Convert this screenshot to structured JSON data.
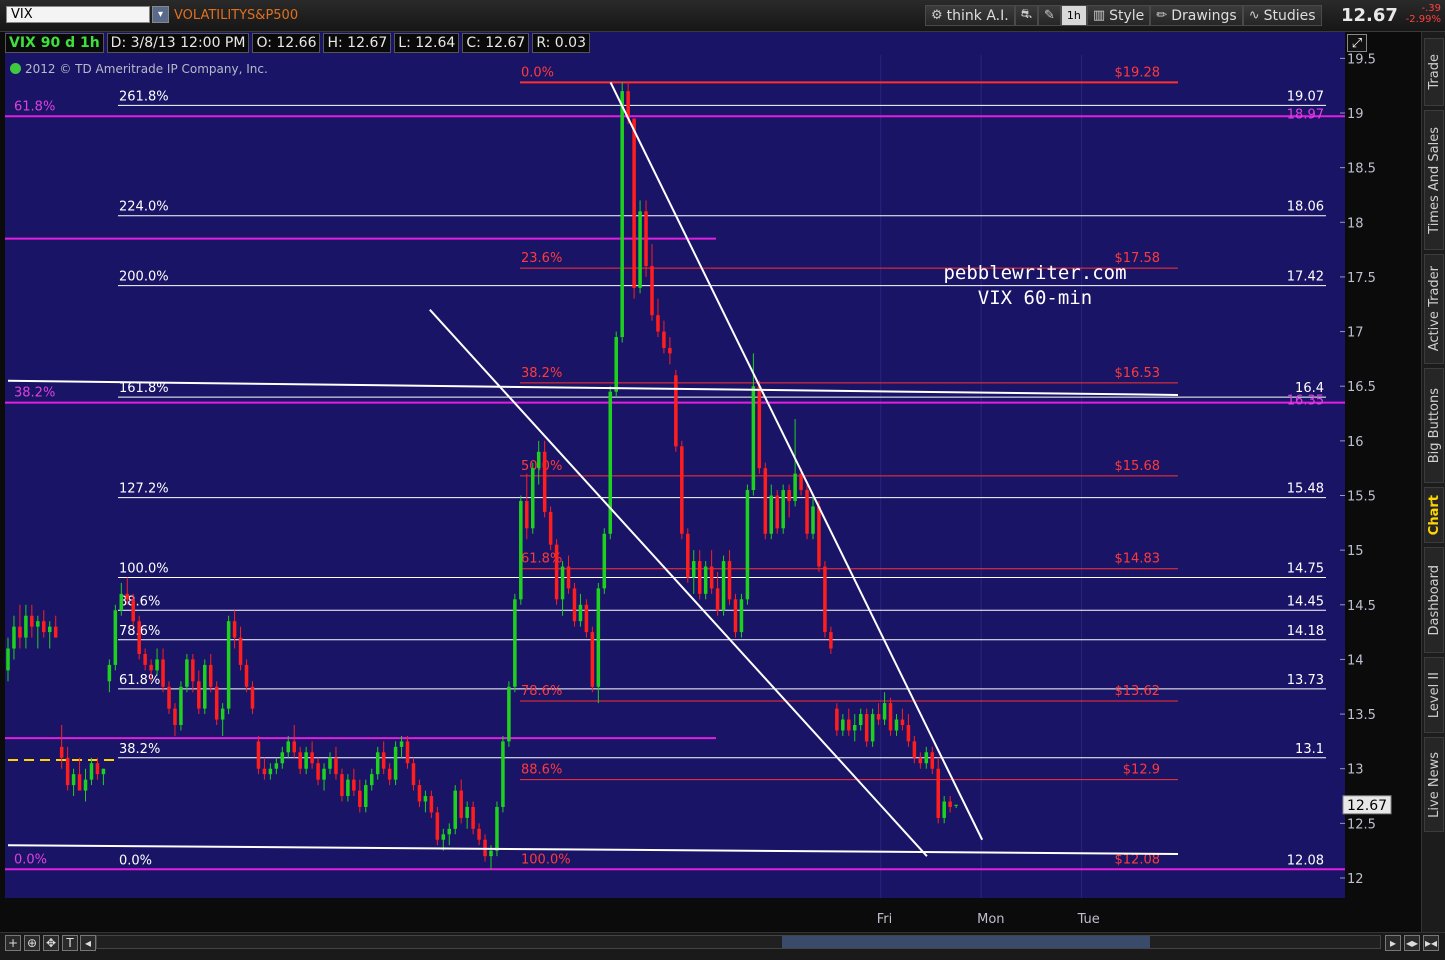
{
  "header": {
    "symbol": "VIX",
    "symbol_description": "VOLATILITYS&P500",
    "last_price": "12.67",
    "change": "-.39",
    "change_pct": "-2.99%",
    "toolbar": [
      {
        "name": "think-ai-button",
        "icon": "gear-icon",
        "label": "think A.I."
      },
      {
        "name": "style-button",
        "icon": "bar-chart-icon",
        "label": "Style"
      },
      {
        "name": "drawings-button",
        "icon": "pencil-icon",
        "label": "Drawings"
      },
      {
        "name": "studies-button",
        "icon": "wave-icon",
        "label": "Studies"
      }
    ],
    "timeframe_label": "1h"
  },
  "info_bar": {
    "symbol_period": "VIX 90 d 1h",
    "date": "D: 3/8/13 12:00 PM",
    "open": "O: 12.66",
    "high": "H: 12.67",
    "low": "L: 12.64",
    "close": "C: 12.67",
    "range": "R: 0.03"
  },
  "copyright": "2012 © TD Ameritrade IP Company, Inc.",
  "right_panel": {
    "tabs": [
      "Trade",
      "Times And Sales",
      "Active Trader",
      "Big Buttons",
      "Chart",
      "Dashboard",
      "Level II",
      "Live News"
    ],
    "active": "Chart"
  },
  "colors": {
    "background": "#1a1466",
    "up_candle": "#1fd11f",
    "down_candle": "#ff1e1e",
    "fib_red": "#ff3030",
    "fib_magenta": "#e020e0",
    "white_line": "#ffffff"
  },
  "chart_data": {
    "type": "candlestick",
    "title": "",
    "watermark": [
      "pebblewriter.com",
      "VIX 60-min"
    ],
    "ylim": [
      11.85,
      19.6
    ],
    "y_ticks": [
      12,
      12.5,
      13,
      13.5,
      14,
      14.5,
      15,
      15.5,
      16,
      16.5,
      17,
      17.5,
      18,
      18.5,
      19,
      19.5
    ],
    "x_tick_labels": [
      "Fri",
      "Mon",
      "Tue"
    ],
    "x_range_bars": [
      0,
      233
    ],
    "last_price_tag": 12.67,
    "fib_extension_white": [
      {
        "label": "261.8%",
        "price_label": "19.07",
        "value": 19.07
      },
      {
        "label": "224.0%",
        "price_label": "18.06",
        "value": 18.06
      },
      {
        "label": "200.0%",
        "price_label": "17.42",
        "value": 17.42
      },
      {
        "label": "161.8%",
        "price_label": "16.4",
        "value": 16.4
      },
      {
        "label": "127.2%",
        "price_label": "15.48",
        "value": 15.48
      },
      {
        "label": "100.0%",
        "price_label": "14.75",
        "value": 14.75
      },
      {
        "label": "88.6%",
        "price_label": "14.45",
        "value": 14.45
      },
      {
        "label": "78.6%",
        "price_label": "14.18",
        "value": 14.18
      },
      {
        "label": "61.8%",
        "price_label": "13.73",
        "value": 13.73
      },
      {
        "label": "38.2%",
        "price_label": "13.1",
        "value": 13.1
      },
      {
        "label": "0.0%",
        "price_label": "12.08",
        "value": 12.08
      }
    ],
    "fib_retracement_red": [
      {
        "label": "0.0%",
        "price_label": "$19.28",
        "value": 19.28
      },
      {
        "label": "23.6%",
        "price_label": "$17.58",
        "value": 17.58
      },
      {
        "label": "38.2%",
        "price_label": "$16.53",
        "value": 16.53
      },
      {
        "label": "50.0%",
        "price_label": "$15.68",
        "value": 15.68
      },
      {
        "label": "61.8%",
        "price_label": "$14.83",
        "value": 14.83
      },
      {
        "label": "78.6%",
        "price_label": "$13.62",
        "value": 13.62
      },
      {
        "label": "88.6%",
        "price_label": "$12.9",
        "value": 12.9
      },
      {
        "label": "100.0%",
        "price_label": "$12.08",
        "value": 12.08
      }
    ],
    "fib_magenta": [
      {
        "label": "61.8%",
        "price_label": "18.97",
        "value": 18.97,
        "x_end_bar": 233
      },
      {
        "label": "",
        "price_label": "",
        "value": 17.85,
        "x_end_bar": 141
      },
      {
        "label": "38.2%",
        "price_label": "16.35",
        "value": 16.35,
        "x_end_bar": 233
      },
      {
        "label": "",
        "price_label": "",
        "value": 13.28,
        "x_end_bar": 141
      },
      {
        "label": "0.0%",
        "price_label": "",
        "value": 12.08,
        "x_end_bar": 233
      }
    ],
    "trendlines": [
      {
        "from": [
          84,
          17.2
        ],
        "to": [
          183,
          12.2
        ]
      },
      {
        "from": [
          120,
          19.28
        ],
        "to": [
          194,
          12.35
        ]
      },
      {
        "from": [
          0,
          12.3
        ],
        "to": [
          233,
          12.22
        ]
      },
      {
        "from": [
          0,
          16.55
        ],
        "to": [
          233,
          16.42
        ]
      }
    ],
    "yellow_dashed": {
      "value": 13.08,
      "x_range_bars": [
        0,
        22
      ]
    },
    "candles": [
      [
        13.9,
        14.2,
        13.8,
        14.1
      ],
      [
        14.1,
        14.4,
        14.0,
        14.3
      ],
      [
        14.3,
        14.5,
        14.1,
        14.2
      ],
      [
        14.2,
        14.5,
        14.1,
        14.4
      ],
      [
        14.4,
        14.5,
        14.2,
        14.3
      ],
      [
        14.3,
        14.4,
        14.1,
        14.35
      ],
      [
        14.35,
        14.45,
        14.2,
        14.25
      ],
      [
        14.25,
        14.35,
        14.1,
        14.3
      ],
      [
        14.3,
        14.4,
        14.2,
        14.2
      ],
      [
        13.2,
        13.4,
        13.0,
        13.1
      ],
      [
        13.1,
        13.2,
        12.8,
        12.85
      ],
      [
        12.85,
        13.0,
        12.75,
        12.95
      ],
      [
        12.95,
        13.1,
        12.8,
        12.8
      ],
      [
        12.8,
        13.0,
        12.7,
        12.9
      ],
      [
        12.9,
        13.1,
        12.85,
        13.05
      ],
      [
        13.05,
        13.1,
        12.9,
        12.95
      ],
      [
        12.95,
        13.0,
        12.85,
        13.0
      ],
      [
        13.8,
        14.0,
        13.7,
        13.95
      ],
      [
        13.95,
        14.5,
        13.9,
        14.45
      ],
      [
        14.45,
        14.7,
        14.4,
        14.6
      ],
      [
        14.6,
        14.75,
        14.5,
        14.55
      ],
      [
        14.55,
        14.6,
        14.3,
        14.35
      ],
      [
        14.35,
        14.4,
        14.0,
        14.05
      ],
      [
        14.05,
        14.1,
        13.9,
        13.95
      ],
      [
        13.95,
        14.0,
        13.8,
        13.9
      ],
      [
        13.9,
        14.1,
        13.85,
        14.0
      ],
      [
        14.0,
        14.1,
        13.7,
        13.75
      ],
      [
        13.75,
        13.8,
        13.5,
        13.55
      ],
      [
        13.55,
        13.6,
        13.3,
        13.4
      ],
      [
        13.4,
        13.8,
        13.35,
        13.75
      ],
      [
        13.75,
        14.05,
        13.7,
        14.0
      ],
      [
        14.0,
        14.05,
        13.7,
        13.8
      ],
      [
        13.8,
        13.9,
        13.5,
        13.55
      ],
      [
        13.55,
        14.0,
        13.5,
        13.95
      ],
      [
        13.95,
        14.05,
        13.7,
        13.75
      ],
      [
        13.75,
        13.8,
        13.4,
        13.45
      ],
      [
        13.45,
        13.6,
        13.3,
        13.55
      ],
      [
        13.55,
        14.4,
        13.5,
        14.35
      ],
      [
        14.35,
        14.45,
        14.1,
        14.2
      ],
      [
        14.2,
        14.3,
        13.9,
        13.95
      ],
      [
        13.95,
        14.0,
        13.7,
        13.75
      ],
      [
        13.75,
        13.8,
        13.5,
        13.55
      ],
      [
        13.25,
        13.3,
        12.95,
        13.0
      ],
      [
        13.0,
        13.1,
        12.9,
        12.95
      ],
      [
        12.95,
        13.05,
        12.9,
        13.0
      ],
      [
        13.0,
        13.1,
        12.95,
        13.05
      ],
      [
        13.05,
        13.2,
        13.0,
        13.15
      ],
      [
        13.15,
        13.3,
        13.1,
        13.25
      ],
      [
        13.25,
        13.4,
        13.1,
        13.15
      ],
      [
        13.15,
        13.2,
        12.95,
        13.0
      ],
      [
        13.0,
        13.2,
        12.95,
        13.15
      ],
      [
        13.15,
        13.25,
        13.0,
        13.05
      ],
      [
        13.05,
        13.1,
        12.85,
        12.9
      ],
      [
        12.9,
        13.05,
        12.8,
        13.0
      ],
      [
        13.0,
        13.15,
        12.95,
        13.1
      ],
      [
        13.1,
        13.2,
        12.9,
        12.95
      ],
      [
        12.95,
        13.0,
        12.7,
        12.75
      ],
      [
        12.75,
        12.95,
        12.7,
        12.9
      ],
      [
        12.9,
        13.0,
        12.75,
        12.8
      ],
      [
        12.8,
        12.9,
        12.6,
        12.65
      ],
      [
        12.65,
        12.9,
        12.6,
        12.85
      ],
      [
        12.85,
        13.0,
        12.8,
        12.95
      ],
      [
        12.95,
        13.2,
        12.9,
        13.15
      ],
      [
        13.15,
        13.25,
        12.95,
        13.0
      ],
      [
        13.0,
        13.05,
        12.85,
        12.9
      ],
      [
        12.9,
        13.25,
        12.85,
        13.2
      ],
      [
        13.2,
        13.3,
        13.1,
        13.25
      ],
      [
        13.25,
        13.3,
        13.0,
        13.05
      ],
      [
        13.05,
        13.1,
        12.8,
        12.85
      ],
      [
        12.85,
        12.9,
        12.65,
        12.7
      ],
      [
        12.7,
        12.8,
        12.6,
        12.75
      ],
      [
        12.75,
        12.8,
        12.55,
        12.6
      ],
      [
        12.6,
        12.65,
        12.3,
        12.35
      ],
      [
        12.35,
        12.45,
        12.25,
        12.4
      ],
      [
        12.4,
        12.5,
        12.3,
        12.45
      ],
      [
        12.45,
        12.85,
        12.4,
        12.8
      ],
      [
        12.8,
        12.9,
        12.5,
        12.55
      ],
      [
        12.55,
        12.7,
        12.45,
        12.65
      ],
      [
        12.65,
        12.7,
        12.4,
        12.45
      ],
      [
        12.45,
        12.5,
        12.3,
        12.35
      ],
      [
        12.35,
        12.4,
        12.15,
        12.2
      ],
      [
        12.2,
        12.3,
        12.08,
        12.25
      ],
      [
        12.25,
        12.7,
        12.2,
        12.65
      ],
      [
        12.65,
        13.3,
        12.6,
        13.25
      ],
      [
        13.25,
        13.8,
        13.2,
        13.75
      ],
      [
        13.75,
        14.6,
        13.7,
        14.55
      ],
      [
        14.55,
        15.5,
        14.5,
        15.45
      ],
      [
        15.45,
        15.7,
        15.1,
        15.2
      ],
      [
        15.2,
        15.8,
        15.15,
        15.75
      ],
      [
        15.75,
        16.0,
        15.6,
        15.9
      ],
      [
        15.9,
        16.0,
        15.3,
        15.35
      ],
      [
        15.35,
        15.4,
        15.0,
        15.05
      ],
      [
        15.05,
        15.1,
        14.5,
        14.55
      ],
      [
        14.55,
        14.9,
        14.4,
        14.85
      ],
      [
        14.85,
        14.95,
        14.6,
        14.65
      ],
      [
        14.65,
        14.7,
        14.3,
        14.35
      ],
      [
        14.35,
        14.6,
        14.3,
        14.5
      ],
      [
        14.5,
        14.55,
        14.2,
        14.25
      ],
      [
        14.25,
        14.3,
        13.7,
        13.75
      ],
      [
        13.75,
        14.7,
        13.6,
        14.65
      ],
      [
        14.65,
        15.2,
        14.6,
        15.15
      ],
      [
        15.15,
        16.5,
        15.1,
        16.45
      ],
      [
        16.45,
        17.0,
        16.4,
        16.95
      ],
      [
        16.95,
        19.28,
        16.9,
        19.2
      ],
      [
        19.2,
        19.28,
        18.9,
        18.95
      ],
      [
        18.95,
        18.95,
        17.3,
        17.4
      ],
      [
        17.4,
        18.2,
        17.35,
        18.1
      ],
      [
        18.1,
        18.2,
        17.5,
        17.6
      ],
      [
        17.6,
        17.8,
        17.1,
        17.15
      ],
      [
        17.15,
        17.3,
        16.95,
        17.0
      ],
      [
        17.0,
        17.1,
        16.8,
        16.85
      ],
      [
        16.85,
        16.95,
        16.7,
        16.8
      ],
      [
        16.6,
        16.65,
        15.9,
        15.95
      ],
      [
        15.95,
        16.0,
        15.1,
        15.15
      ],
      [
        15.15,
        15.2,
        14.7,
        14.75
      ],
      [
        14.75,
        15.0,
        14.6,
        14.9
      ],
      [
        14.9,
        15.0,
        14.55,
        14.6
      ],
      [
        14.6,
        14.9,
        14.55,
        14.85
      ],
      [
        14.85,
        15.0,
        14.6,
        14.65
      ],
      [
        14.65,
        14.8,
        14.4,
        14.45
      ],
      [
        14.45,
        14.95,
        14.4,
        14.9
      ],
      [
        14.9,
        15.0,
        14.5,
        14.55
      ],
      [
        14.55,
        14.6,
        14.2,
        14.25
      ],
      [
        14.25,
        14.6,
        14.2,
        14.55
      ],
      [
        14.55,
        15.6,
        14.5,
        15.55
      ],
      [
        15.55,
        16.8,
        15.5,
        16.5
      ],
      [
        16.5,
        16.55,
        15.7,
        15.75
      ],
      [
        15.75,
        15.8,
        15.1,
        15.15
      ],
      [
        15.15,
        15.6,
        15.1,
        15.5
      ],
      [
        15.5,
        15.55,
        15.15,
        15.2
      ],
      [
        15.2,
        15.6,
        15.15,
        15.55
      ],
      [
        15.55,
        15.6,
        15.3,
        15.45
      ],
      [
        15.45,
        16.2,
        15.4,
        15.7
      ],
      [
        15.7,
        15.75,
        15.5,
        15.55
      ],
      [
        15.55,
        15.6,
        15.1,
        15.15
      ],
      [
        15.15,
        15.5,
        15.1,
        15.4
      ],
      [
        15.4,
        15.45,
        14.8,
        14.85
      ],
      [
        14.85,
        14.9,
        14.2,
        14.25
      ],
      [
        14.25,
        14.3,
        14.05,
        14.1
      ],
      [
        13.55,
        13.6,
        13.3,
        13.35
      ],
      [
        13.35,
        13.5,
        13.3,
        13.45
      ],
      [
        13.45,
        13.55,
        13.3,
        13.35
      ],
      [
        13.35,
        13.5,
        13.25,
        13.4
      ],
      [
        13.4,
        13.55,
        13.35,
        13.5
      ],
      [
        13.5,
        13.55,
        13.2,
        13.25
      ],
      [
        13.25,
        13.55,
        13.2,
        13.5
      ],
      [
        13.5,
        13.6,
        13.4,
        13.45
      ],
      [
        13.45,
        13.7,
        13.4,
        13.6
      ],
      [
        13.6,
        13.65,
        13.3,
        13.35
      ],
      [
        13.35,
        13.5,
        13.3,
        13.45
      ],
      [
        13.45,
        13.55,
        13.35,
        13.4
      ],
      [
        13.4,
        13.5,
        13.2,
        13.25
      ],
      [
        13.25,
        13.3,
        13.05,
        13.1
      ],
      [
        13.1,
        13.15,
        13.0,
        13.05
      ],
      [
        13.05,
        13.2,
        13.0,
        13.15
      ],
      [
        13.15,
        13.2,
        12.95,
        13.0
      ],
      [
        13.0,
        13.1,
        12.5,
        12.55
      ],
      [
        12.55,
        12.75,
        12.5,
        12.7
      ],
      [
        12.7,
        12.75,
        12.6,
        12.65
      ],
      [
        12.66,
        12.67,
        12.64,
        12.67
      ]
    ]
  }
}
